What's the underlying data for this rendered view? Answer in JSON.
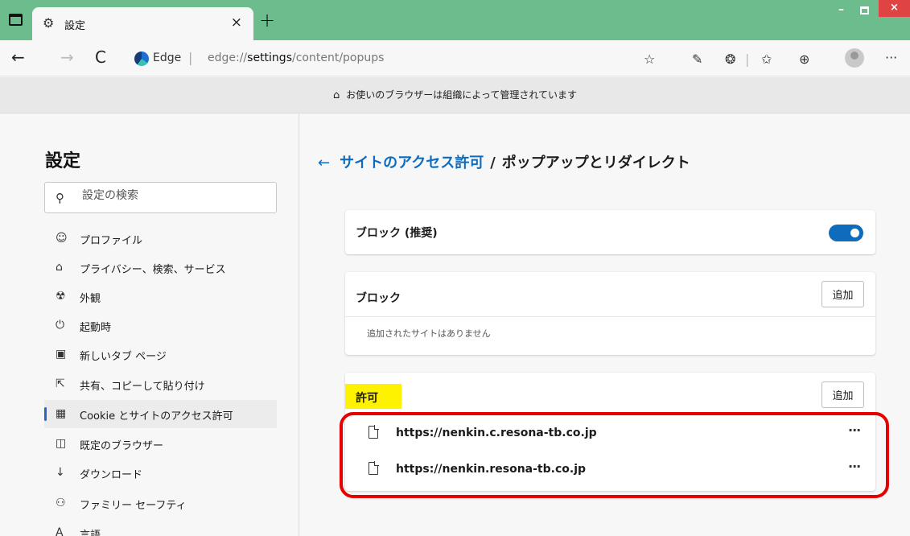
{
  "tab": {
    "title": "設定",
    "close": "×",
    "new_tab": "+"
  },
  "window_controls": {
    "minimize": "–",
    "close": "×"
  },
  "toolbar": {
    "back": "←",
    "forward": "→",
    "refresh": "C",
    "address_brand": "Edge",
    "address_separator": "|",
    "url_prefix": "edge://",
    "url_bold": "settings",
    "url_suffix": "/content/popups",
    "more": "···"
  },
  "banner": {
    "icon": "briefcase-icon",
    "text": "お使いのブラウザーは組織によって管理されています"
  },
  "sidebar": {
    "title": "設定",
    "search_placeholder": "設定の検索",
    "items": [
      {
        "icon": "profile-icon",
        "glyph": "☺",
        "label": "プロファイル"
      },
      {
        "icon": "lock-icon",
        "glyph": "⌂",
        "label": "プライバシー、検索、サービス"
      },
      {
        "icon": "palette-icon",
        "glyph": "☢",
        "label": "外観"
      },
      {
        "icon": "power-icon",
        "glyph": "⏻",
        "label": "起動時"
      },
      {
        "icon": "new-tab-icon",
        "glyph": "▣",
        "label": "新しいタブ ページ"
      },
      {
        "icon": "share-icon",
        "glyph": "⇱",
        "label": "共有、コピーして貼り付け"
      },
      {
        "icon": "cookie-icon",
        "glyph": "▦",
        "label": "Cookie とサイトのアクセス許可"
      },
      {
        "icon": "browser-icon",
        "glyph": "◫",
        "label": "既定のブラウザー"
      },
      {
        "icon": "download-icon",
        "glyph": "↓",
        "label": "ダウンロード"
      },
      {
        "icon": "family-icon",
        "glyph": "⚇",
        "label": "ファミリー セーフティ"
      },
      {
        "icon": "language-icon",
        "glyph": "A",
        "label": "言語"
      }
    ],
    "active_index": 6
  },
  "main": {
    "breadcrumb_back": "←",
    "breadcrumb_parent": "サイトのアクセス許可",
    "breadcrumb_separator": "/",
    "breadcrumb_current": "ポップアップとリダイレクト",
    "block_recommended": {
      "label": "ブロック (推奨)",
      "enabled": true
    },
    "block_section": {
      "title": "ブロック",
      "add_label": "追加",
      "empty_message": "追加されたサイトはありません"
    },
    "allow_section": {
      "title": "許可",
      "add_label": "追加",
      "sites": [
        {
          "url": "https://nenkin.c.resona-tb.co.jp",
          "more": "···"
        },
        {
          "url": "https://nenkin.resona-tb.co.jp",
          "more": "···"
        }
      ]
    }
  },
  "colors": {
    "accent": "#0f6cbd",
    "titlebar": "#6cbc8d",
    "highlight": "#fff200",
    "annotation": "#e60000"
  }
}
